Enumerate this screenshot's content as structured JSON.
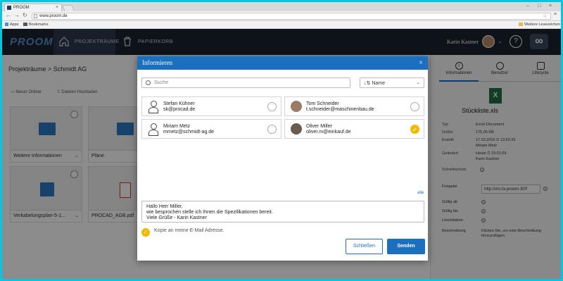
{
  "browser": {
    "tab_title": "PROOM",
    "url": "www.proom.de",
    "bookmarks": [
      "Apps",
      "Bookmarks"
    ],
    "other_bookmarks": "Weitere Lesezeichen"
  },
  "app": {
    "logo": "PROOM",
    "nav": [
      "PROJEKTRÄUME",
      "PAPIERKORB"
    ],
    "user": "Karin Kastner",
    "help": "?",
    "brand_icon": "∞"
  },
  "main": {
    "breadcrumb": "Projekträume  >  Schmidt AG",
    "actions": [
      "Neuer Ordner",
      "Dateien Hochladen"
    ],
    "cards": [
      "Weitere Informationen",
      "Pläne",
      "Verkabelungsplan-5-1...",
      "PROCAD_AGB.pdf"
    ]
  },
  "right_panel": {
    "tabs": [
      "Informationen",
      "Benutzer",
      "Lifecycle"
    ],
    "file_name": "Stückliste.xls",
    "props": [
      {
        "k": "Typ",
        "v": "Excel Document"
      },
      {
        "k": "Größe",
        "v": "175,00 KB"
      },
      {
        "k": "Erstellt",
        "v": "17.03.2016  ⏲ 13:52:33"
      },
      {
        "k": "",
        "v": "Miriam Metz"
      },
      {
        "k": "Geändert",
        "v": "Heute  ⏲ 15:01:03"
      },
      {
        "k": "",
        "v": "Karin Kastner"
      },
      {
        "k": "Schreibschutz",
        "v": ""
      }
    ],
    "freigabe_label": "Freigabe",
    "freigabe_value": "http://vm-fa-proom-30/f",
    "props2": [
      "Gültig ab",
      "Gültig bis",
      "Löschdatum"
    ],
    "beschreibung_label": "Beschreibung",
    "beschreibung_value": "Klicken Sie, um eine Beschreibung hinzuzufügen."
  },
  "modal": {
    "title": "Informieren",
    "search_placeholder": "Suche",
    "sort_label": "Name",
    "users": [
      {
        "name": "Stefan Kühner",
        "email": "sk@procad.de",
        "checked": false
      },
      {
        "name": "Tom Schneider",
        "email": "t.schneider@maschinenbau.de",
        "checked": false
      },
      {
        "name": "Miriam Metz",
        "email": "mmetz@schmidt-ag.de",
        "checked": false
      },
      {
        "name": "Oliver Miller",
        "email": "oliver.m@einkauf.de",
        "checked": true
      }
    ],
    "all_link": "alle",
    "message_lines": [
      "Hallo Herr Miller,",
      "wie besprochen stelle ich Ihnen die Spezifikationen bereit.",
      "Viele Grüße - Karin Kastner"
    ],
    "copy_label": "Kopie an meine E-Mail Adresse.",
    "close_button": "Schließen",
    "send_button": "Senden"
  }
}
